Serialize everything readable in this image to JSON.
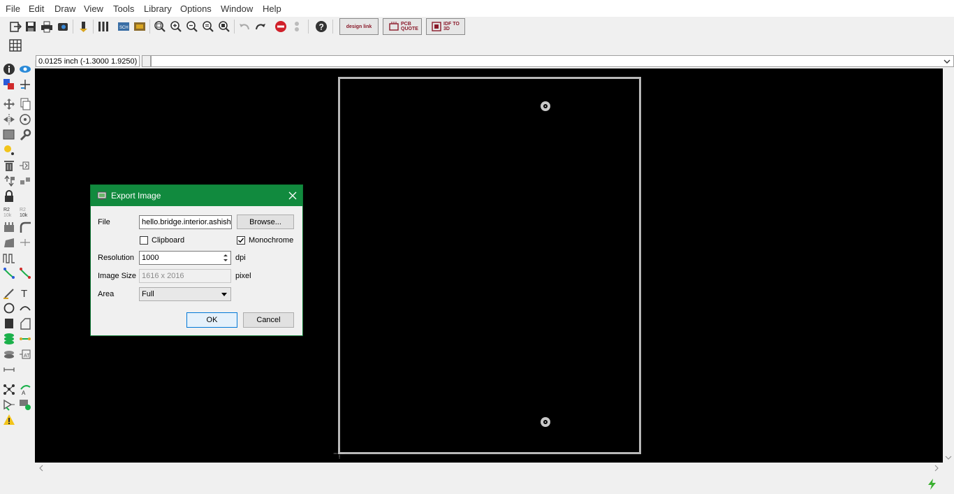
{
  "menu": [
    "File",
    "Edit",
    "Draw",
    "View",
    "Tools",
    "Library",
    "Options",
    "Window",
    "Help"
  ],
  "toolbar": {
    "designlink_label": "design link",
    "pcbquote_label": "PCB QUOTE",
    "idf_label": "IDF TO 3D"
  },
  "coordinate_readout": "0.0125 inch (-1.3000 1.9250)",
  "command_line": "",
  "dialog": {
    "title": "Export Image",
    "file_label": "File",
    "file_value": "hello.bridge.interior.ashish",
    "browse_label": "Browse...",
    "clipboard_label": "Clipboard",
    "clipboard_checked": false,
    "monochrome_label": "Monochrome",
    "monochrome_checked": true,
    "resolution_label": "Resolution",
    "resolution_value": "1000",
    "resolution_unit": "dpi",
    "image_size_label": "Image Size",
    "image_size_value": "1616 x 2016",
    "image_size_unit": "pixel",
    "area_label": "Area",
    "area_value": "Full",
    "ok_label": "OK",
    "cancel_label": "Cancel"
  },
  "colors": {
    "dialog_title_bg": "#118a3e",
    "canvas_bg": "#000000",
    "board_outline": "#b8b8b8"
  }
}
